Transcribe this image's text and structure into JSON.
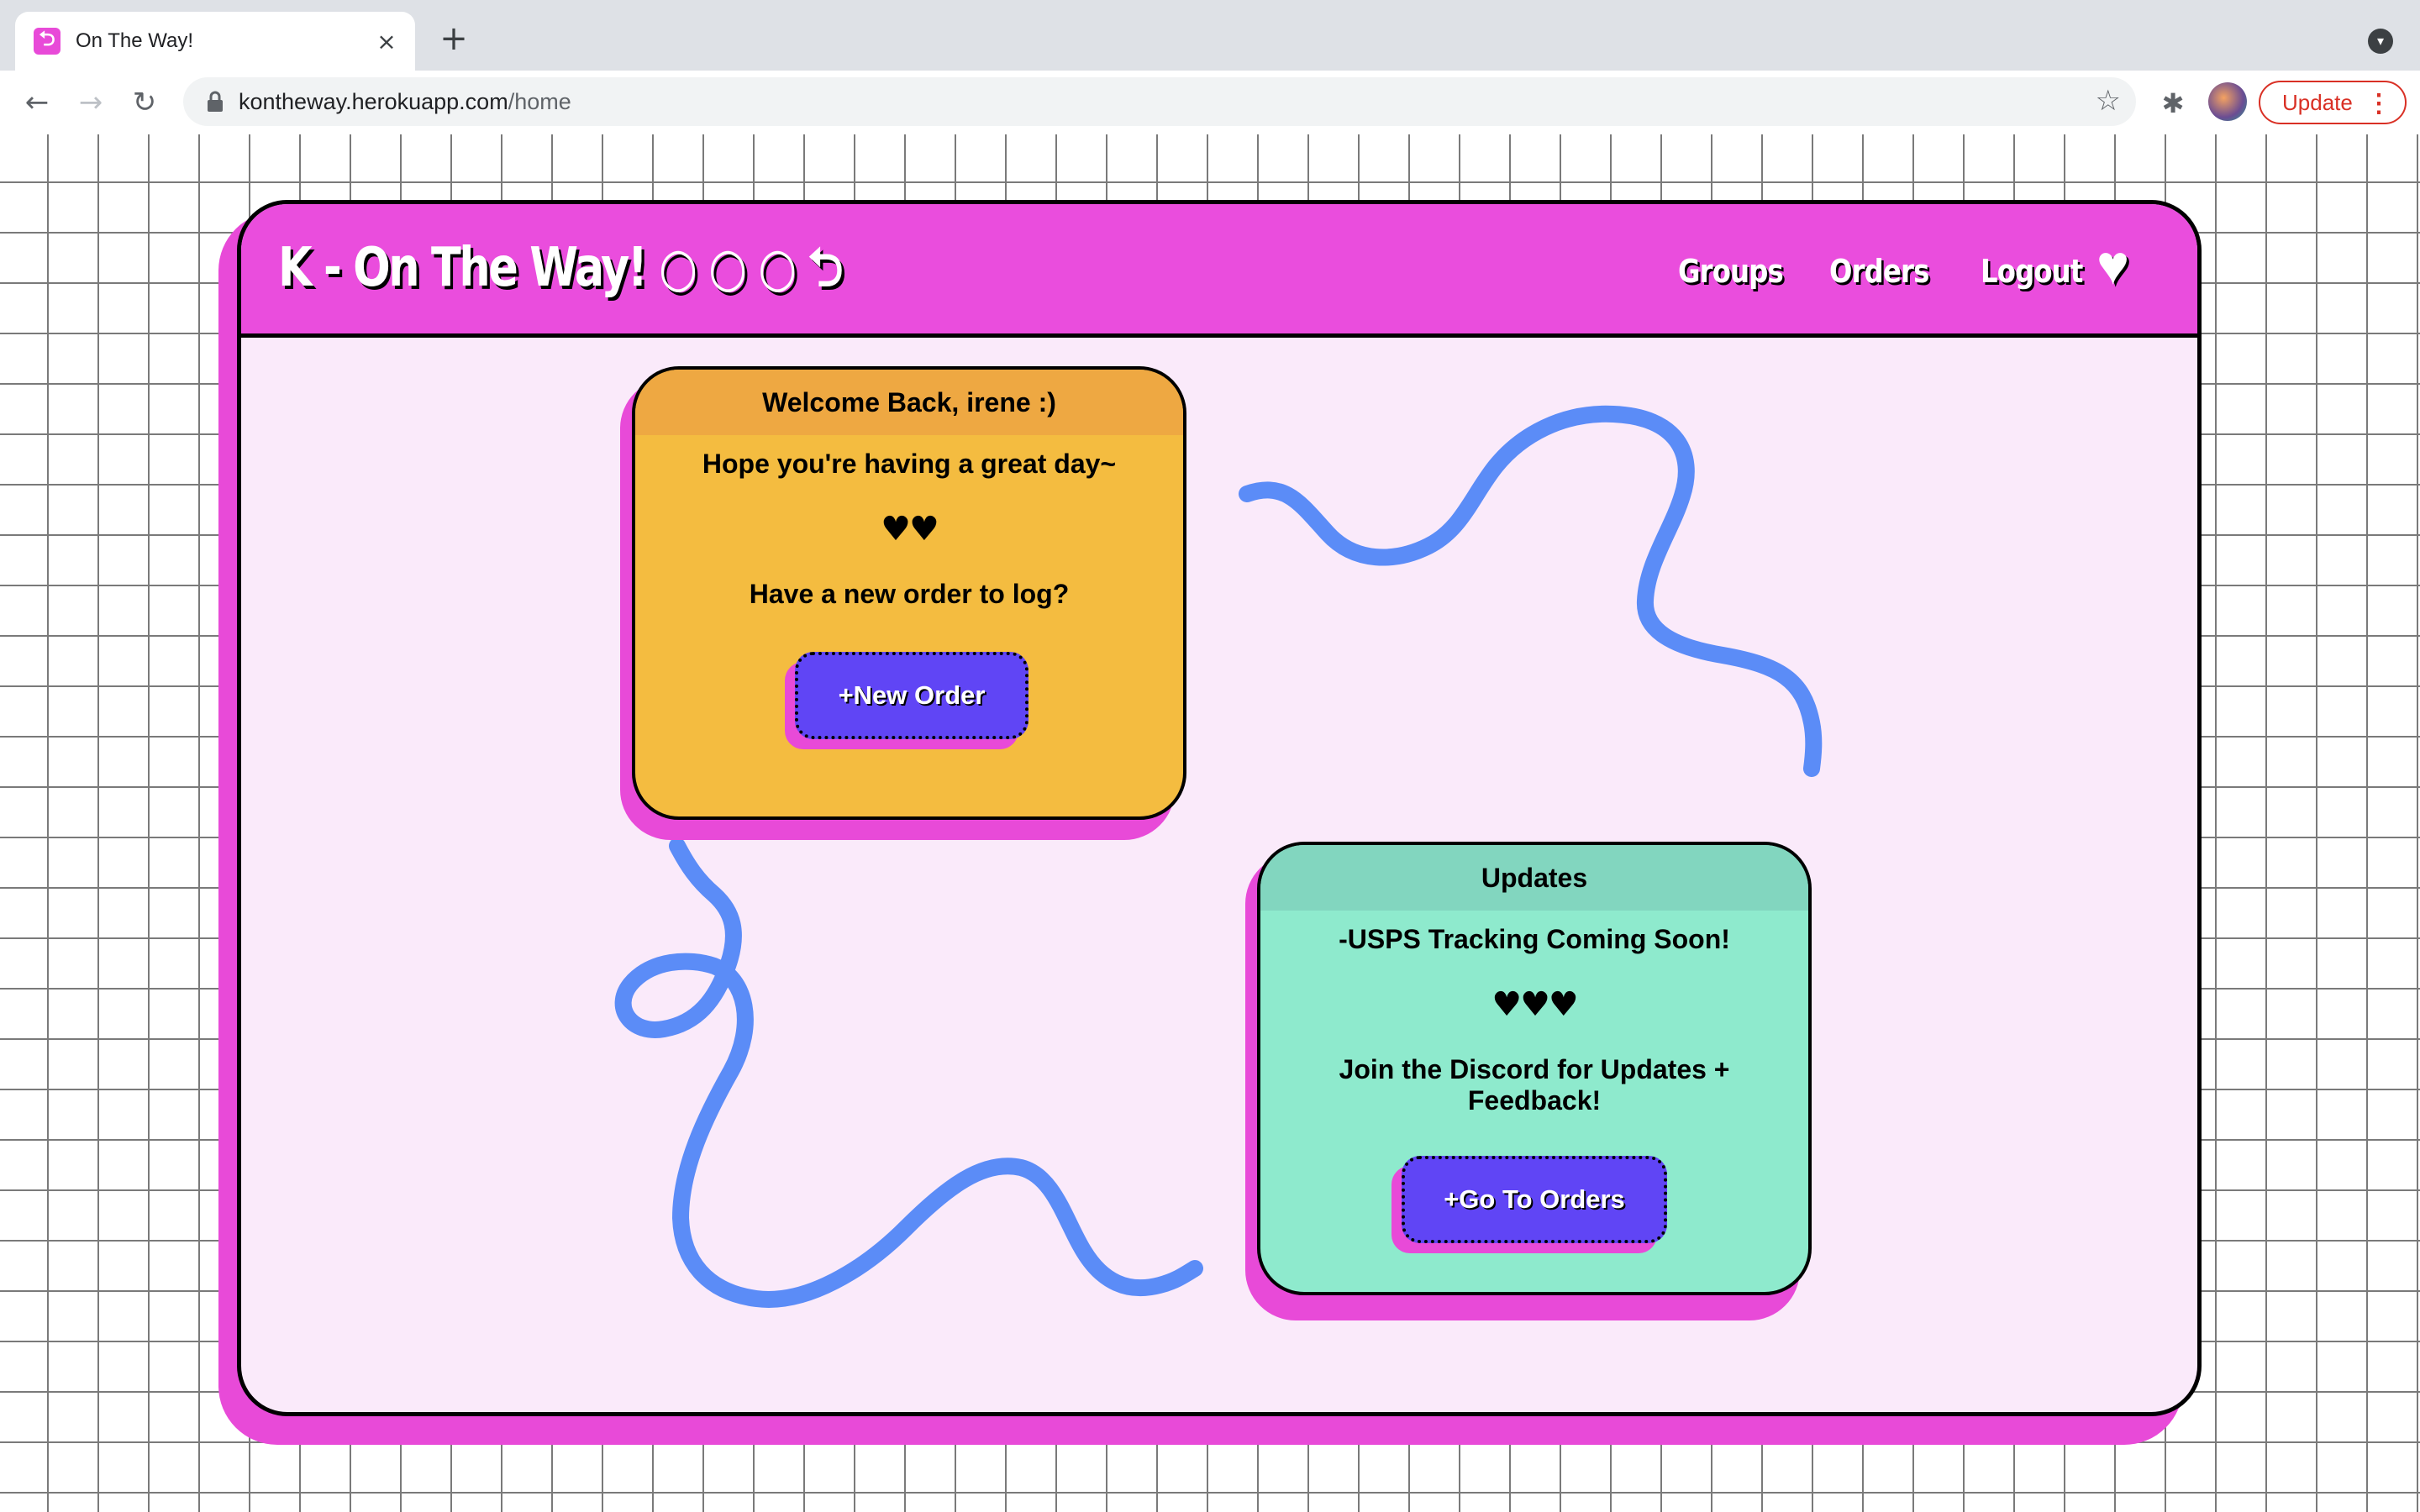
{
  "browser": {
    "tab_favicon": "⮌",
    "tab_title": "On The Way!",
    "tab_close": "×",
    "new_tab": "+",
    "url_host": "kontheway.herokuapp.com",
    "url_path": "/home",
    "update_label": "Update",
    "menu_dots": "⋮"
  },
  "header": {
    "brand": "K - On The Way! ○ ○ ○ ⮌",
    "nav": [
      {
        "label": "Groups"
      },
      {
        "label": "Orders"
      },
      {
        "label": "Logout"
      }
    ],
    "heart": "♥"
  },
  "welcome_card": {
    "title": "Welcome Back, irene :)",
    "line1": "Hope you're having a great day~",
    "hearts": "♥♥",
    "line2": "Have a new order to log?",
    "button": "+New Order",
    "colors": {
      "header": "#eea842",
      "body": "#f4bc40"
    }
  },
  "updates_card": {
    "title": "Updates",
    "line1": "-USPS Tracking Coming Soon!",
    "hearts": "♥♥♥",
    "line2": "Join the Discord for Updates + Feedback!",
    "button": "+Go To Orders",
    "colors": {
      "header": "#82d6bf",
      "body": "#8eeacd"
    }
  },
  "colors": {
    "accent_pink": "#ea4ddd",
    "button_purple": "#6045f5",
    "squiggle_blue": "#5b8cf7",
    "app_bg": "#faeafa"
  }
}
